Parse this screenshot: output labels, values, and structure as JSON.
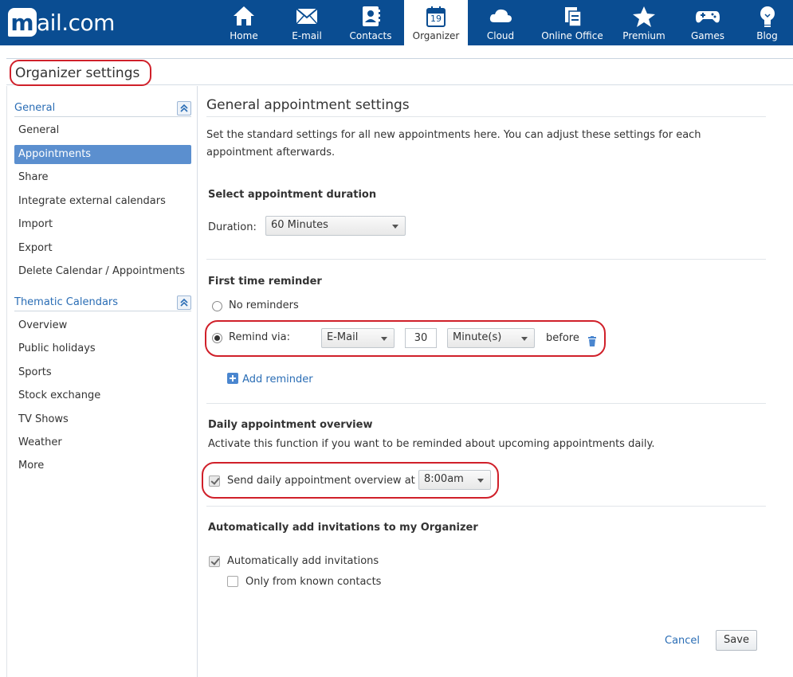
{
  "brand": {
    "logo_text": "mail.com",
    "logo_letter": "m",
    "logo_rest": "ail.com"
  },
  "nav": {
    "items": [
      {
        "label": "Home",
        "icon": "home-icon"
      },
      {
        "label": "E-mail",
        "icon": "envelope-icon"
      },
      {
        "label": "Contacts",
        "icon": "contacts-icon"
      },
      {
        "label": "Organizer",
        "icon": "calendar-icon",
        "badge": "19",
        "active": true
      },
      {
        "label": "Cloud",
        "icon": "cloud-icon"
      },
      {
        "label": "Online Office",
        "icon": "documents-icon"
      },
      {
        "label": "Premium",
        "icon": "star-icon"
      },
      {
        "label": "Games",
        "icon": "gamepad-icon"
      },
      {
        "label": "Blog",
        "icon": "lightbulb-icon"
      }
    ]
  },
  "page": {
    "title": "Organizer settings"
  },
  "sidebar": {
    "general_section": {
      "heading": "General",
      "items": [
        "General",
        "Appointments",
        "Share",
        "Integrate external calendars",
        "Import",
        "Export",
        "Delete Calendar / Appointments"
      ],
      "selected": "Appointments"
    },
    "thematic_section": {
      "heading": "Thematic Calendars",
      "items": [
        "Overview",
        "Public holidays",
        "Sports",
        "Stock exchange",
        "TV Shows",
        "Weather",
        "More"
      ]
    }
  },
  "main": {
    "title": "General appointment settings",
    "description": "Set the standard settings for all new appointments here. You can adjust these settings for each appointment afterwards.",
    "duration": {
      "heading": "Select appointment duration",
      "label": "Duration:",
      "value": "60 Minutes"
    },
    "reminder": {
      "heading": "First time reminder",
      "no_reminders_label": "No reminders",
      "remind_via_label": "Remind via:",
      "via_value": "E-Mail",
      "amount_value": "30",
      "unit_value": "Minute(s)",
      "before_label": "before",
      "add_reminder_label": "Add reminder",
      "selected_option": "Remind via:"
    },
    "daily": {
      "heading": "Daily appointment overview",
      "description": "Activate this function if you want to be reminded about upcoming appointments daily.",
      "send_label": "Send daily appointment overview at",
      "send_checked": true,
      "time_value": "8:00am"
    },
    "invitations": {
      "heading": "Automatically add invitations to my Organizer",
      "auto_add_label": "Automatically add invitations",
      "auto_add_checked": true,
      "known_contacts_label": "Only from known contacts",
      "known_contacts_checked": false
    },
    "actions": {
      "cancel_label": "Cancel",
      "save_label": "Save"
    }
  },
  "colors": {
    "header_bg": "#0a4d92",
    "link": "#2a6db5",
    "selected_bg": "#5b8fcf",
    "highlight_circle": "#d0202a"
  }
}
